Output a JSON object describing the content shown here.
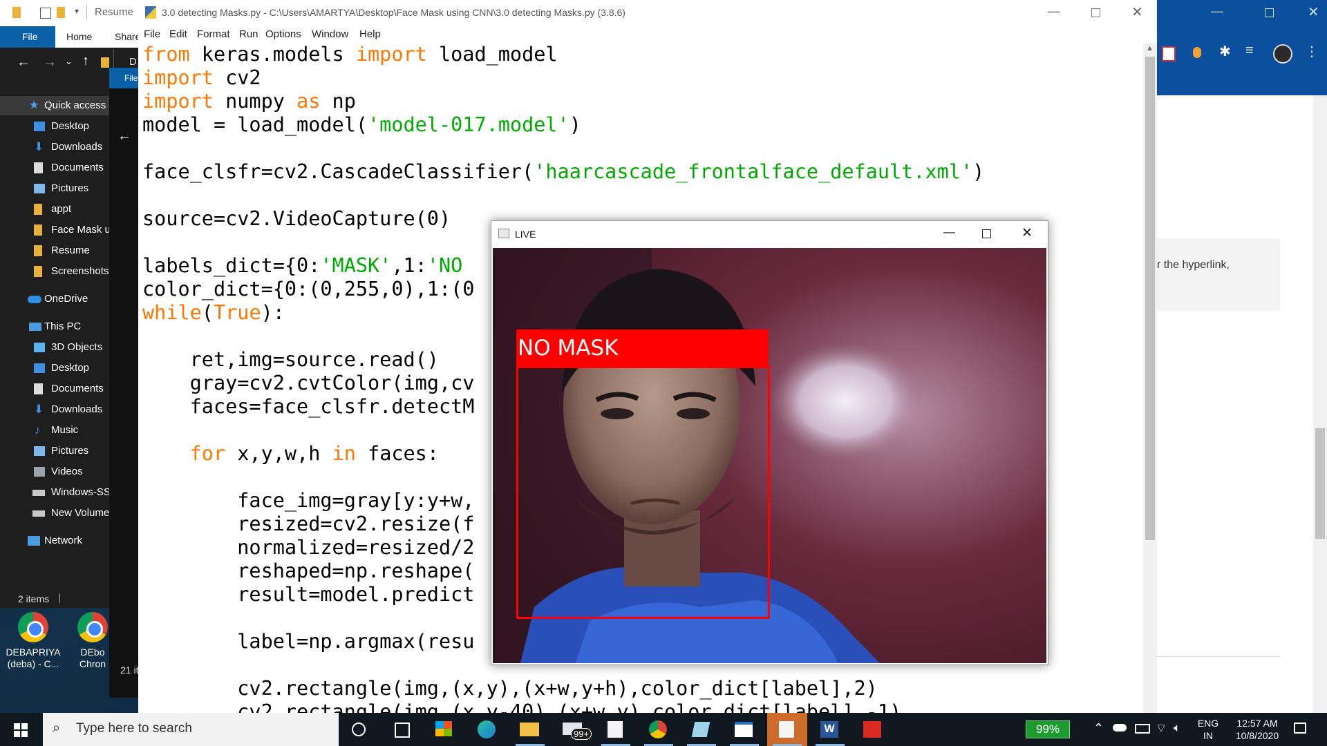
{
  "explorer": {
    "title": "Resume",
    "ribbon_tabs": [
      "File",
      "Home",
      "Share"
    ],
    "inner_tab": "File",
    "address_stub": "D",
    "nav": [
      {
        "label": "Quick access",
        "icon": "star-icon"
      },
      {
        "label": "Desktop",
        "icon": "desktop-icon"
      },
      {
        "label": "Downloads",
        "icon": "download-icon"
      },
      {
        "label": "Documents",
        "icon": "documents-icon"
      },
      {
        "label": "Pictures",
        "icon": "pictures-icon"
      },
      {
        "label": "appt",
        "icon": "folder-icon"
      },
      {
        "label": "Face Mask us",
        "icon": "folder-icon"
      },
      {
        "label": "Resume",
        "icon": "folder-icon"
      },
      {
        "label": "Screenshots",
        "icon": "folder-icon"
      },
      {
        "label": "OneDrive",
        "icon": "cloud-icon"
      },
      {
        "label": "This PC",
        "icon": "computer-icon"
      },
      {
        "label": "3D Objects",
        "icon": "cube-icon"
      },
      {
        "label": "Desktop",
        "icon": "desktop-icon"
      },
      {
        "label": "Documents",
        "icon": "documents-icon"
      },
      {
        "label": "Downloads",
        "icon": "download-icon"
      },
      {
        "label": "Music",
        "icon": "music-icon"
      },
      {
        "label": "Pictures",
        "icon": "pictures-icon"
      },
      {
        "label": "Videos",
        "icon": "videos-icon"
      },
      {
        "label": "Windows-SS",
        "icon": "drive-icon"
      },
      {
        "label": "New Volume",
        "icon": "drive-icon"
      },
      {
        "label": "Network",
        "icon": "network-icon"
      }
    ],
    "status": "2 items",
    "status2": "21 it"
  },
  "desktop_icons": [
    {
      "line1": "DEBAPRIYA",
      "line2": "(deba) - C..."
    },
    {
      "line1": "DEbo",
      "line2": "Chron"
    }
  ],
  "idle": {
    "title": "3.0 detecting Masks.py - C:\\Users\\AMARTYA\\Desktop\\Face Mask using CNN\\3.0 detecting Masks.py (3.8.6)",
    "menu": [
      "File",
      "Edit",
      "Format",
      "Run",
      "Options",
      "Window",
      "Help"
    ]
  },
  "live_window": {
    "title": "LIVE",
    "label_text": "NO MASK",
    "box_color": "#ff0000"
  },
  "browser": {
    "side_text": "r the hyperlink,"
  },
  "taskbar": {
    "search_placeholder": "Type here to search",
    "mail_badge": "99+",
    "battery": "99%",
    "lang1": "ENG",
    "lang2": "IN",
    "time": "12:57 AM",
    "date": "10/8/2020"
  },
  "colors": {
    "keyword": "#ff7700",
    "string": "#00aa00",
    "accent": "#0b5fa5"
  }
}
